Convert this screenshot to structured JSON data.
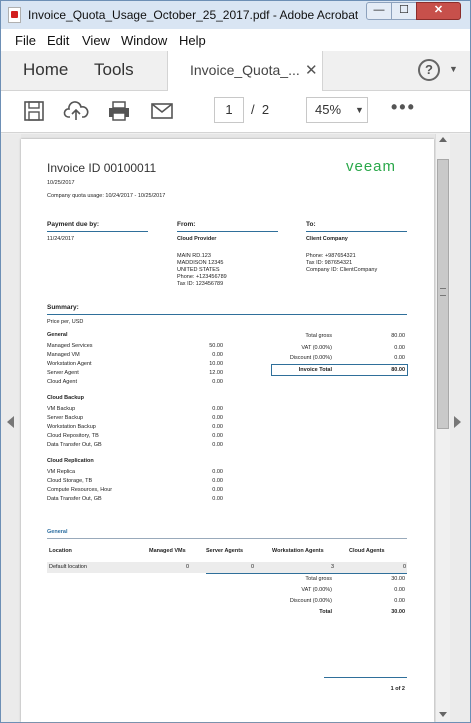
{
  "window": {
    "title": "Invoice_Quota_Usage_October_25_2017.pdf - Adobe Acrobat Reader DC",
    "minimize": "—",
    "maximize": "☐",
    "close": "✕"
  },
  "menubar": [
    "File",
    "Edit",
    "View",
    "Window",
    "Help"
  ],
  "tabs": {
    "home": "Home",
    "tools": "Tools",
    "document": "Invoice_Quota_...",
    "close": "✕",
    "help": "?"
  },
  "toolbar": {
    "page_current": "1",
    "page_sep": "/",
    "page_total": "2",
    "zoom": "45%",
    "more": "•••"
  },
  "colors": {
    "accent": "#2c6ea0",
    "logo": "#2aa84a",
    "close": "#c7504b"
  },
  "doc": {
    "title": "Invoice ID 00100011",
    "logo": "veeam",
    "date": "10/25/2017",
    "quota": "Company quota usage: 10/24/2017 - 10/25/2017",
    "payment_label": "Payment due by:",
    "payment_date": "11/24/2017",
    "from_label": "From:",
    "from_name": "Cloud Provider",
    "from_lines": [
      "MAIN RD.123",
      "MADDISON 12345",
      "UNITED STATES",
      "Phone: +123456789",
      "Tax ID: 123456789"
    ],
    "to_label": "To:",
    "to_name": "Client Company",
    "to_lines": [
      "Phone: +987654321",
      "Tax ID: 987654321",
      "Company ID: ClientCompany"
    ],
    "summary": "Summary:",
    "price": "Price per, USD",
    "groups": [
      {
        "name": "General",
        "items": [
          [
            "Managed Services",
            "50.00"
          ],
          [
            "Managed VM",
            "0.00"
          ],
          [
            "Workstation Agent",
            "10.00"
          ],
          [
            "Server Agent",
            "12.00"
          ],
          [
            "Cloud Agent",
            "0.00"
          ]
        ]
      },
      {
        "name": "Cloud Backup",
        "items": [
          [
            "VM Backup",
            "0.00"
          ],
          [
            "Server Backup",
            "0.00"
          ],
          [
            "Workstation Backup",
            "0.00"
          ],
          [
            "Cloud Repository, TB",
            "0.00"
          ],
          [
            "Data Transfer Out, GB",
            "0.00"
          ]
        ]
      },
      {
        "name": "Cloud Replication",
        "items": [
          [
            "VM Replica",
            "0.00"
          ],
          [
            "Cloud Storage, TB",
            "0.00"
          ],
          [
            "Compute Resources, Hour",
            "0.00"
          ],
          [
            "Data Transfer Out, GB",
            "0.00"
          ]
        ]
      }
    ],
    "totals": [
      [
        "Total gross",
        "80.00"
      ],
      [
        "VAT (0.00%)",
        "0.00"
      ],
      [
        "Discount (0.00%)",
        "0.00"
      ]
    ],
    "invoice_total": [
      "Invoice Total",
      "80.00"
    ],
    "general2": "General",
    "table_headers": [
      "Location",
      "Managed VMs",
      "Server Agents",
      "Workstation Agents",
      "Cloud  Agents"
    ],
    "table_row": [
      "Default location",
      "0",
      "0",
      "3",
      "0"
    ],
    "totals2": [
      [
        "Total gross",
        "30.00"
      ],
      [
        "VAT (0.00%)",
        "0.00"
      ],
      [
        "Discount (0.00%)",
        "0.00"
      ],
      [
        "Total",
        "30.00"
      ]
    ],
    "page_footer": "1 of 2"
  }
}
